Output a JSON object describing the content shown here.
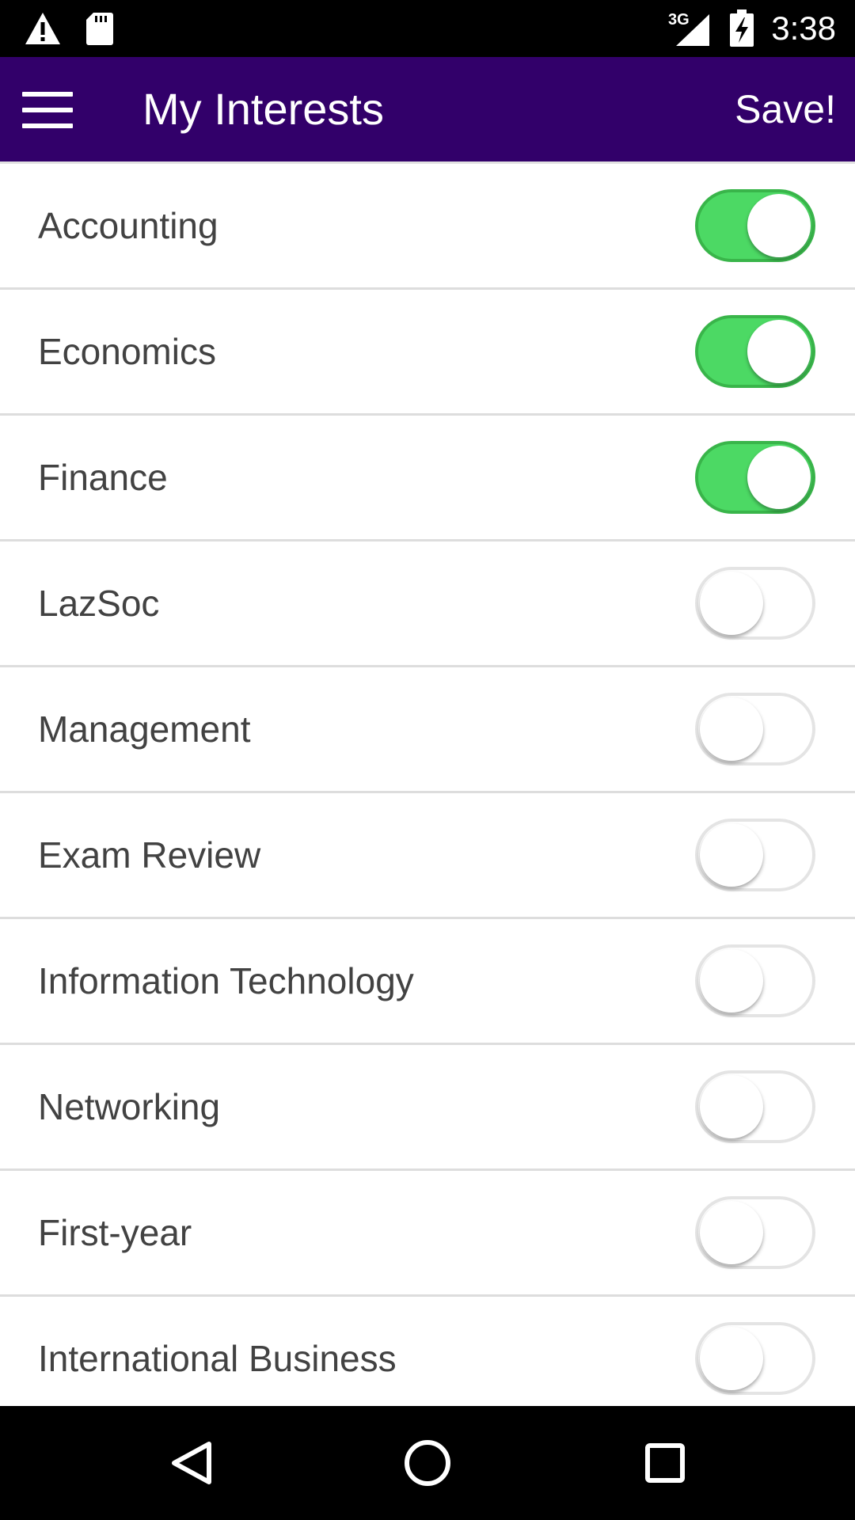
{
  "status_bar": {
    "time": "3:38",
    "network": "3G",
    "icons": [
      "warning-icon",
      "sd-card-icon",
      "signal-icon",
      "battery-charging-icon"
    ]
  },
  "app_bar": {
    "title": "My Interests",
    "save_label": "Save!",
    "background": "#32006a",
    "menu_icon": "hamburger-menu-icon"
  },
  "interests": [
    {
      "label": "Accounting",
      "enabled": true
    },
    {
      "label": "Economics",
      "enabled": true
    },
    {
      "label": "Finance",
      "enabled": true
    },
    {
      "label": "LazSoc",
      "enabled": false
    },
    {
      "label": "Management",
      "enabled": false
    },
    {
      "label": "Exam Review",
      "enabled": false
    },
    {
      "label": "Information Technology",
      "enabled": false
    },
    {
      "label": "Networking",
      "enabled": false
    },
    {
      "label": "First-year",
      "enabled": false
    },
    {
      "label": "International Business",
      "enabled": false
    }
  ],
  "colors": {
    "toggle_on": "#4cd964",
    "toggle_off_border": "#e4e4e4"
  },
  "nav_bar": {
    "icons": [
      "back-icon",
      "home-icon",
      "recents-icon"
    ]
  }
}
